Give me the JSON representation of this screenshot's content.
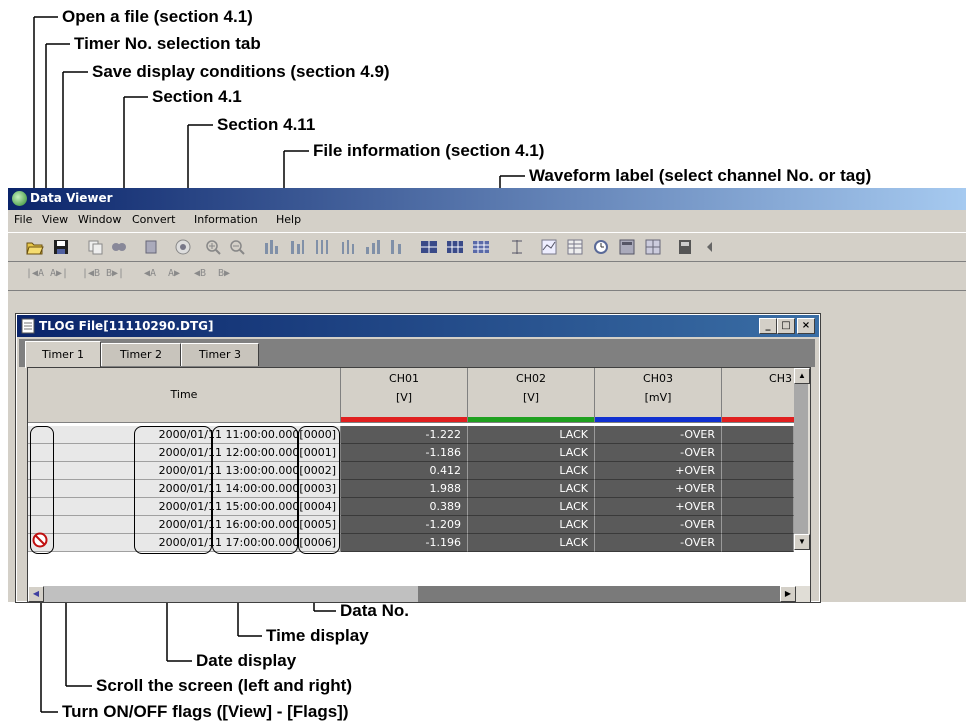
{
  "callouts": {
    "open_file": "Open a file (section 4.1)",
    "timer_tab": "Timer No. selection tab",
    "save_display": "Save display conditions (section 4.9)",
    "section_41": "Section 4.1",
    "section_411": "Section 4.11",
    "file_info": "File information (section 4.1)",
    "waveform_label": "Waveform label (select channel No. or tag)",
    "data_no": "Data No.",
    "time_display": "Time display",
    "date_display": "Date display",
    "scroll": "Scroll the screen (left and right)",
    "flags": "Turn ON/OFF flags ([View] - [Flags])"
  },
  "app": {
    "title": "Data Viewer",
    "menu": [
      "File",
      "View",
      "Window",
      "Convert",
      "Information",
      "Help"
    ]
  },
  "child": {
    "title": "TLOG File[11110290.DTG]",
    "tabs": [
      "Timer 1",
      "Timer 2",
      "Timer 3"
    ],
    "time_header": "Time",
    "columns": [
      {
        "name": "CH01",
        "unit": "[V]",
        "color": "#e02020"
      },
      {
        "name": "CH02",
        "unit": "[V]",
        "color": "#20a020"
      },
      {
        "name": "CH03",
        "unit": "[mV]",
        "color": "#1030d0"
      },
      {
        "name": "CH3",
        "unit": "",
        "color": "#e02020"
      }
    ],
    "rows": [
      {
        "date": "2000/01/11",
        "time": "11:00:00.000",
        "no": "[0000]",
        "ch01": "-1.222",
        "ch02": "LACK",
        "ch03": "-OVER"
      },
      {
        "date": "2000/01/11",
        "time": "12:00:00.000",
        "no": "[0001]",
        "ch01": "-1.186",
        "ch02": "LACK",
        "ch03": "-OVER"
      },
      {
        "date": "2000/01/11",
        "time": "13:00:00.000",
        "no": "[0002]",
        "ch01": "0.412",
        "ch02": "LACK",
        "ch03": "+OVER"
      },
      {
        "date": "2000/01/11",
        "time": "14:00:00.000",
        "no": "[0003]",
        "ch01": "1.988",
        "ch02": "LACK",
        "ch03": "+OVER"
      },
      {
        "date": "2000/01/11",
        "time": "15:00:00.000",
        "no": "[0004]",
        "ch01": "0.389",
        "ch02": "LACK",
        "ch03": "+OVER"
      },
      {
        "date": "2000/01/11",
        "time": "16:00:00.000",
        "no": "[0005]",
        "ch01": "-1.209",
        "ch02": "LACK",
        "ch03": "-OVER"
      },
      {
        "date": "2000/01/11",
        "time": "17:00:00.000",
        "no": "[0006]",
        "ch01": "-1.196",
        "ch02": "LACK",
        "ch03": "-OVER"
      }
    ]
  },
  "toolbar2_labels": [
    "A",
    "A",
    "B",
    "B",
    "A",
    "A",
    "B",
    "B"
  ]
}
